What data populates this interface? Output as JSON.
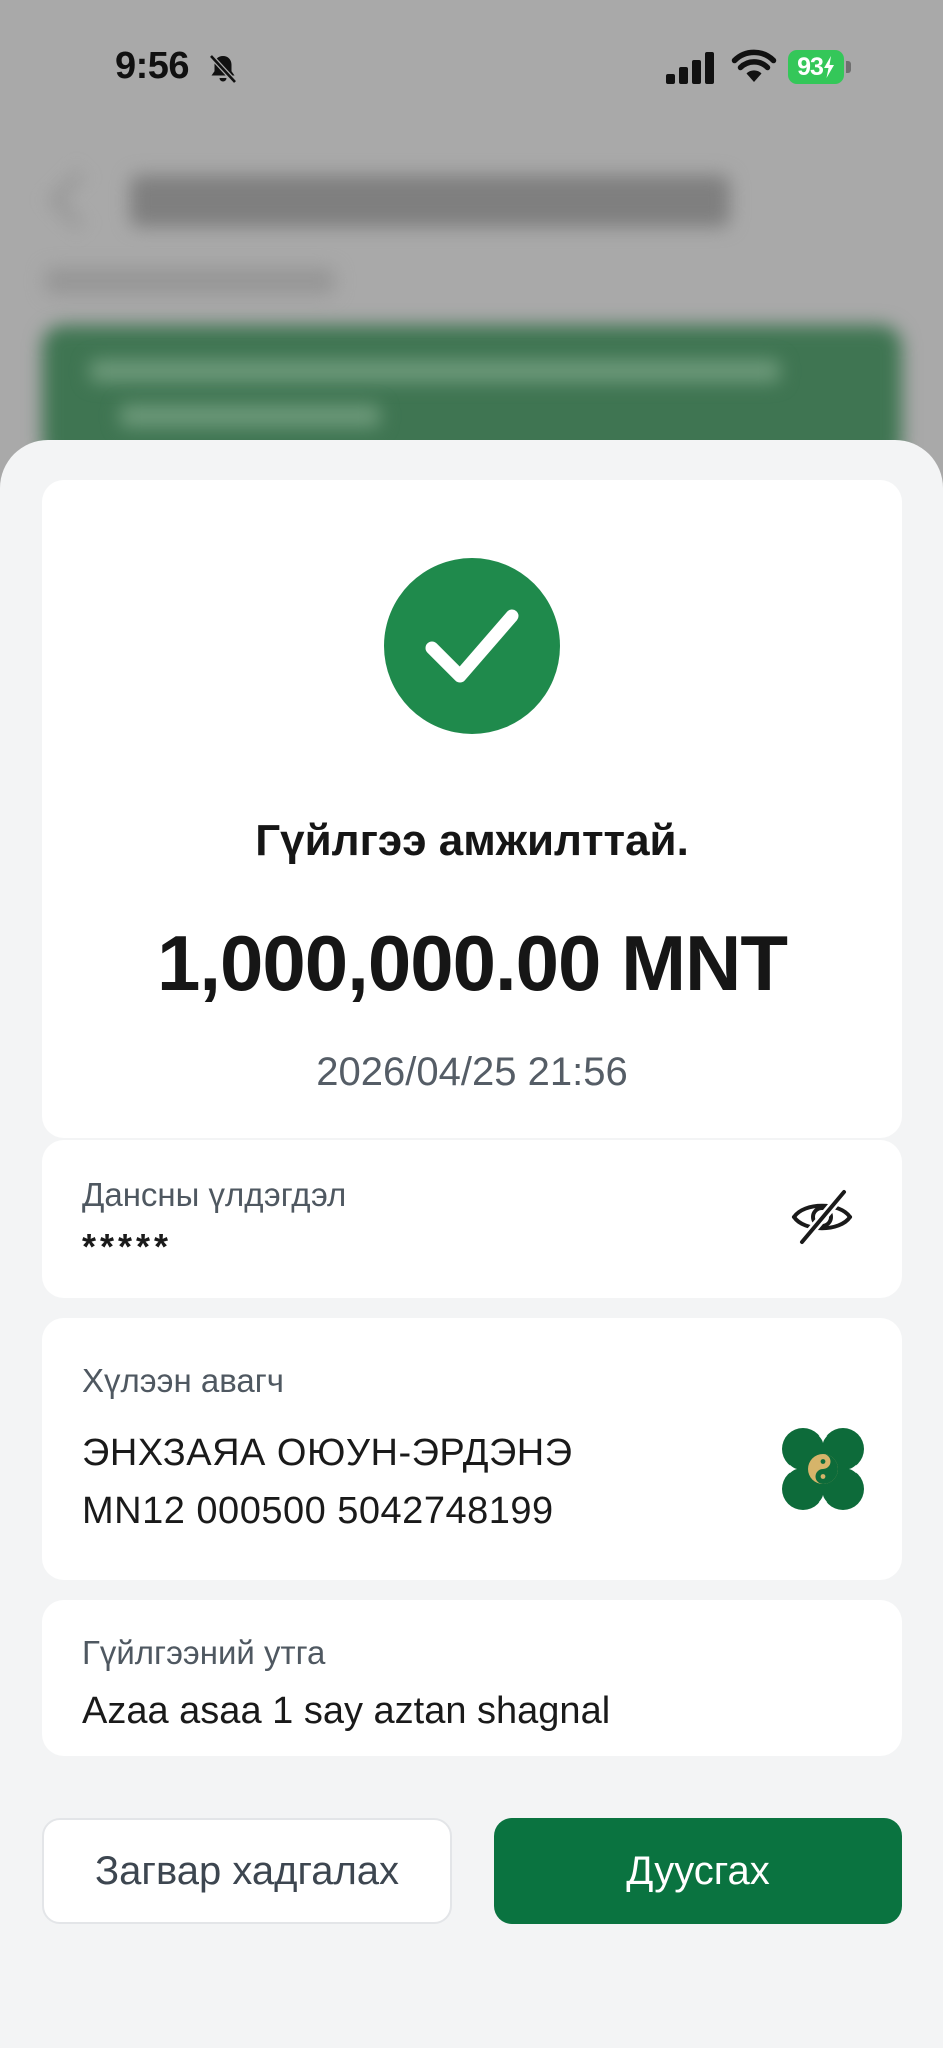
{
  "status_bar": {
    "time": "9:56",
    "battery": "93",
    "icons": [
      "bell-slash-icon",
      "signal-icon",
      "wifi-icon",
      "battery-charging-icon"
    ]
  },
  "result": {
    "icon": "check-icon",
    "title": "Гүйлгээ амжилттай.",
    "amount": "1,000,000.00 MNT",
    "datetime": "2026/04/25 21:56"
  },
  "balance": {
    "label": "Дансны үлдэгдэл",
    "value": "*****",
    "toggle_icon": "eye-off-icon"
  },
  "recipient": {
    "label": "Хүлээн авагч",
    "name": "ЭНХЗАЯА ОЮУН-ЭРДЭНЭ",
    "account": "MN12 000500 5042748199",
    "bank_icon": "bank-logo-icon"
  },
  "description": {
    "label": "Гүйлгээний утга",
    "value": "Azaa asaa 1 say aztan shagnal"
  },
  "actions": {
    "save_label": "Загвар хадгалах",
    "finish_label": "Дуусгах"
  },
  "colors": {
    "accent": "#0a7340",
    "success": "#1f8a4c",
    "battery": "#34c759"
  }
}
